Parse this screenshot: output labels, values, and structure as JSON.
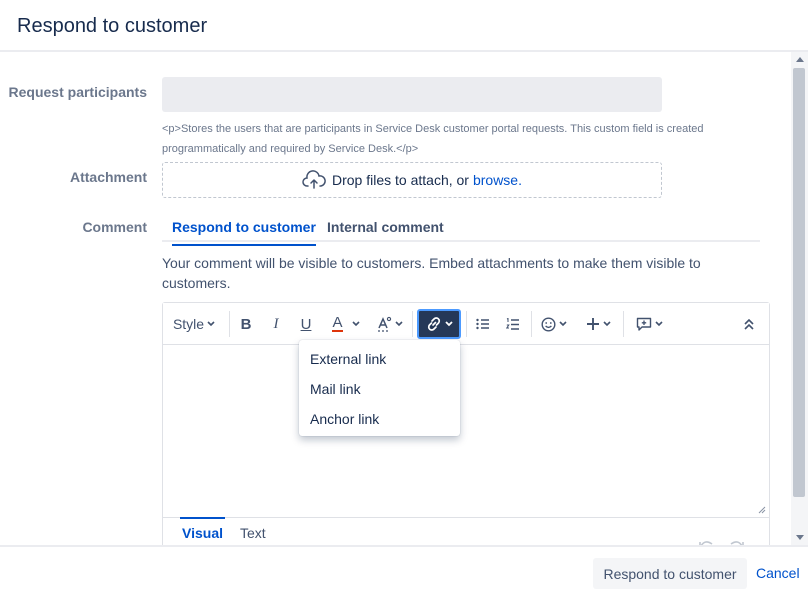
{
  "dialog": {
    "title": "Respond to customer"
  },
  "fields": {
    "participants": {
      "label": "Request participants",
      "value": "",
      "help_text": "<p>Stores the users that are participants in Service Desk customer portal requests. This custom field is created programmatically and required by Service Desk.</p>"
    },
    "attachment": {
      "label": "Attachment",
      "drop_text": "Drop files to attach, or",
      "browse_link": "browse."
    },
    "comment": {
      "label": "Comment",
      "tabs": [
        {
          "label": "Respond to customer",
          "active": true
        },
        {
          "label": "Internal comment",
          "active": false
        }
      ],
      "visibility_note": "Your comment will be visible to customers. Embed attachments to make them visible to customers."
    }
  },
  "editor": {
    "toolbar": {
      "style_label": "Style",
      "bold_icon": "B",
      "italic_icon": "I",
      "underline_icon": "U",
      "text_color_icon": "A"
    },
    "link_menu": {
      "items": [
        "External link",
        "Mail link",
        "Anchor link"
      ]
    },
    "modes": [
      {
        "label": "Visual",
        "active": true
      },
      {
        "label": "Text",
        "active": false
      }
    ]
  },
  "footer": {
    "submit_label": "Respond to customer",
    "cancel_label": "Cancel"
  },
  "colors": {
    "accent": "#0052cc",
    "active_button_bg": "#253858",
    "text_color_underline": "#de350b"
  },
  "icons": [
    "upload-cloud-icon",
    "bold-icon",
    "italic-icon",
    "underline-icon",
    "text-color-icon",
    "text-effects-icon",
    "link-icon",
    "bullet-list-icon",
    "numbered-list-icon",
    "emoji-icon",
    "insert-more-icon",
    "comment-macro-icon",
    "collapse-toolbar-icon",
    "undo-icon",
    "redo-icon",
    "resize-grip-icon"
  ]
}
